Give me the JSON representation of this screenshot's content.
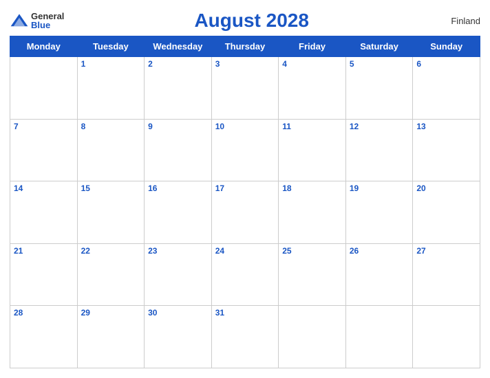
{
  "header": {
    "logo": {
      "general": "General",
      "blue": "Blue"
    },
    "title": "August 2028",
    "country": "Finland"
  },
  "days": [
    "Monday",
    "Tuesday",
    "Wednesday",
    "Thursday",
    "Friday",
    "Saturday",
    "Sunday"
  ],
  "weeks": [
    [
      null,
      1,
      2,
      3,
      4,
      5,
      6
    ],
    [
      7,
      8,
      9,
      10,
      11,
      12,
      13
    ],
    [
      14,
      15,
      16,
      17,
      18,
      19,
      20
    ],
    [
      21,
      22,
      23,
      24,
      25,
      26,
      27
    ],
    [
      28,
      29,
      30,
      31,
      null,
      null,
      null
    ]
  ]
}
